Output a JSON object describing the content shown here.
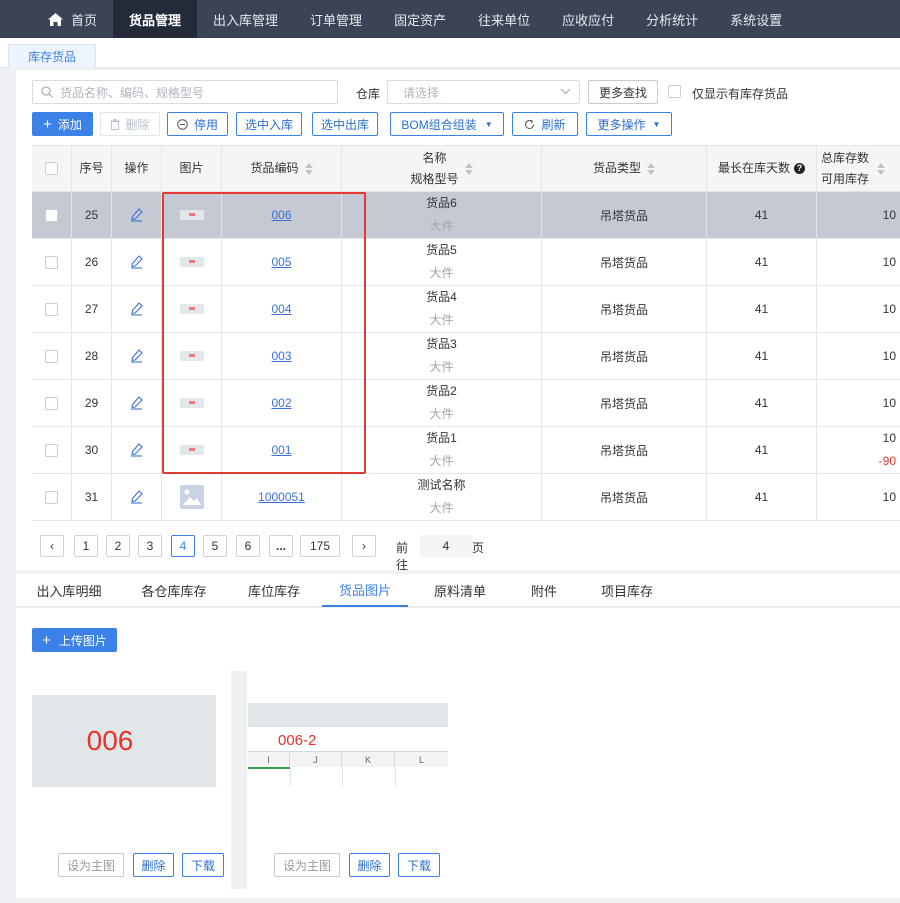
{
  "colors": {
    "nav_bg": "#3b4456",
    "nav_active": "#242b38",
    "accent": "#3c82e6",
    "selected_row": "#c4c9d3",
    "highlight_box": "#e23a31",
    "negative": "#e8332b"
  },
  "topnav": {
    "home": "首页",
    "items": [
      "货品管理",
      "出入库管理",
      "订单管理",
      "固定资产",
      "往来单位",
      "应收应付",
      "分析统计",
      "系统设置"
    ],
    "active": "货品管理"
  },
  "page_tab": "库存货品",
  "filters": {
    "search_placeholder": "货品名称、编码、规格型号",
    "warehouse_label": "仓库",
    "warehouse_placeholder": "请选择",
    "more_search": "更多查找",
    "only_stock_label": "仅显示有库存货品"
  },
  "toolbar": {
    "add": "添加",
    "delete": "删除",
    "disable": "停用",
    "stock_in": "选中入库",
    "stock_out": "选中出库",
    "bom": "BOM组合组装",
    "refresh": "刷新",
    "more_ops": "更多操作"
  },
  "table": {
    "headers": {
      "seq": "序号",
      "op": "操作",
      "image": "图片",
      "code": "货品编码",
      "name": "名称",
      "spec": "规格型号",
      "type": "货品类型",
      "days": "最长在库天数",
      "total_stock": "总库存数",
      "avail_stock": "可用库存"
    },
    "rows": [
      {
        "seq": "25",
        "code": "006",
        "name": "货品6",
        "spec": "大件",
        "type": "吊塔货品",
        "days": "41",
        "stock": "10",
        "avail": "",
        "selected": true
      },
      {
        "seq": "26",
        "code": "005",
        "name": "货品5",
        "spec": "大件",
        "type": "吊塔货品",
        "days": "41",
        "stock": "10",
        "avail": "",
        "selected": false
      },
      {
        "seq": "27",
        "code": "004",
        "name": "货品4",
        "spec": "大件",
        "type": "吊塔货品",
        "days": "41",
        "stock": "10",
        "avail": "",
        "selected": false
      },
      {
        "seq": "28",
        "code": "003",
        "name": "货品3",
        "spec": "大件",
        "type": "吊塔货品",
        "days": "41",
        "stock": "10",
        "avail": "",
        "selected": false
      },
      {
        "seq": "29",
        "code": "002",
        "name": "货品2",
        "spec": "大件",
        "type": "吊塔货品",
        "days": "41",
        "stock": "10",
        "avail": "",
        "selected": false
      },
      {
        "seq": "30",
        "code": "001",
        "name": "货品1",
        "spec": "大件",
        "type": "吊塔货品",
        "days": "41",
        "stock": "10",
        "avail": "-90",
        "selected": false
      },
      {
        "seq": "31",
        "code": "1000051",
        "name": "测试名称",
        "spec": "大件",
        "type": "吊塔货品",
        "days": "41",
        "stock": "10",
        "avail": "",
        "selected": false
      }
    ]
  },
  "pagination": {
    "pages": [
      "1",
      "2",
      "3",
      "4",
      "5",
      "6",
      "...",
      "175"
    ],
    "current": "4",
    "goto_prefix": "前往",
    "goto_value": "4",
    "goto_suffix": "页"
  },
  "bottom_tabs": {
    "items": [
      "出入库明细",
      "各仓库库存",
      "库位库存",
      "货品图片",
      "原料清单",
      "附件",
      "项目库存"
    ],
    "active": "货品图片"
  },
  "images_panel": {
    "upload": "上传图片",
    "cards": [
      {
        "label": "006",
        "set_main": "设为主图",
        "delete": "删除",
        "download": "下载"
      },
      {
        "label": "006-2",
        "set_main": "设为主图",
        "delete": "删除",
        "download": "下载",
        "columns": [
          "I",
          "J",
          "K",
          "L"
        ]
      }
    ]
  }
}
